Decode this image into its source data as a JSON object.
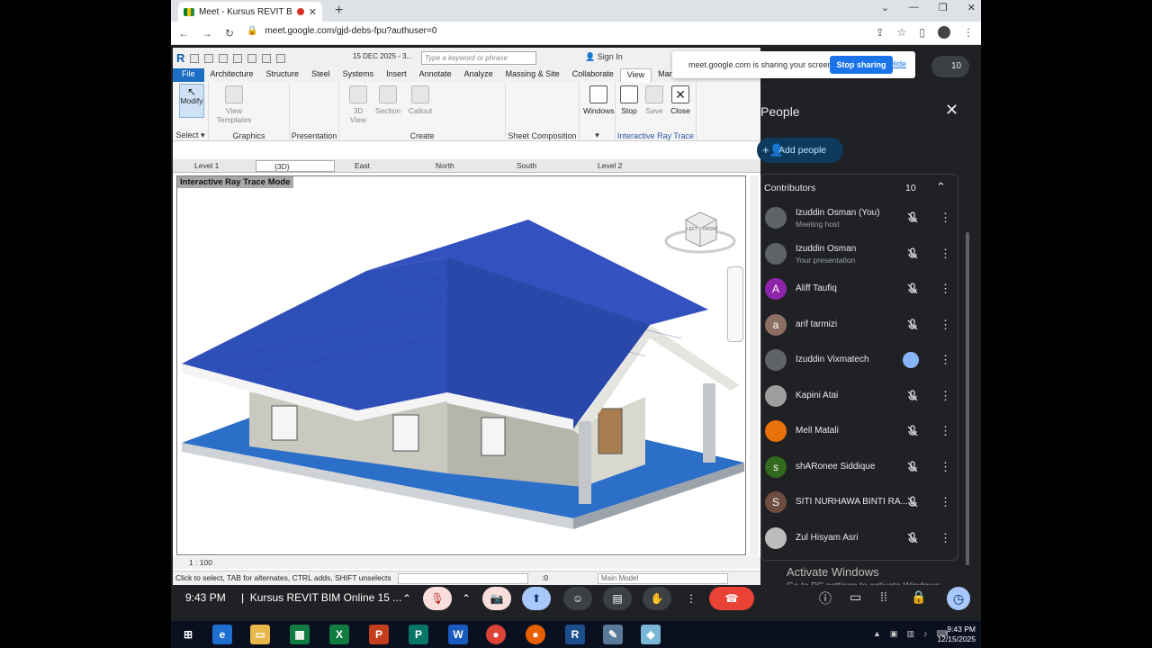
{
  "browser": {
    "tab_title": "Meet - Kursus REVIT BIM Onli",
    "url": "meet.google.com/gjd-debs-fpu?authuser=0"
  },
  "share_popup": {
    "message": "meet.google.com is sharing your screen.",
    "stop_label": "Stop sharing",
    "hide_label": "Hide"
  },
  "revit": {
    "date_field": "15 DEC 2025 - 3...",
    "search_placeholder": "Type a keyword or phrase",
    "signin_label": "Sign In",
    "menus": [
      "File",
      "Architecture",
      "Structure",
      "Steel",
      "Systems",
      "Insert",
      "Annotate",
      "Analyze",
      "Massing & Site",
      "Collaborate",
      "View",
      "Manage"
    ],
    "ribbon": {
      "modify_label": "Modify",
      "select_group": "Select",
      "view_templates": "View Templates",
      "graphics_group": "Graphics",
      "presentation_group": "Presentation",
      "view3d_label": "3D View",
      "section_label": "Section",
      "callout_label": "Callout",
      "create_group": "Create",
      "sheet_group": "Sheet Composition",
      "windows_label": "Windows",
      "stop_label": "Stop",
      "save_label": "Save",
      "close_label": "Close",
      "irt_group": "Interactive Ray Trace"
    },
    "view_tabs": [
      "Level 1",
      "{3D}",
      "East",
      "North",
      "South",
      "Level 2"
    ],
    "mode_label": "Interactive Ray Trace Mode",
    "scale": "1 : 100",
    "status_text": "Click to select, TAB for alternates, CTRL adds, SHIFT unselects",
    "status_zero": ":0",
    "model_field": "Main Model",
    "viewcube_left": "LEFT",
    "viewcube_front": "FRONT"
  },
  "people": {
    "title": "People",
    "add_label": "Add people",
    "contributors_label": "Contributors",
    "contributors_count": "10",
    "top_count": "10",
    "list": [
      {
        "name": "Izuddin Osman (You)",
        "sub": "Meeting host",
        "initial": "",
        "color": "#5f6368",
        "speaking": false
      },
      {
        "name": "Izuddin Osman",
        "sub": "Your presentation",
        "initial": "",
        "color": "#5f6368",
        "speaking": false
      },
      {
        "name": "Aliff Taufiq",
        "sub": "",
        "initial": "A",
        "color": "#8e24aa",
        "speaking": false
      },
      {
        "name": "arif tarmizi",
        "sub": "",
        "initial": "a",
        "color": "#8d6e63",
        "speaking": false
      },
      {
        "name": "Izuddin Vixmatech",
        "sub": "",
        "initial": "",
        "color": "#5f6368",
        "speaking": true
      },
      {
        "name": "Kapini Atai",
        "sub": "",
        "initial": "",
        "color": "#9e9e9e",
        "speaking": false
      },
      {
        "name": "Mell Matali",
        "sub": "",
        "initial": "",
        "color": "#e8710a",
        "speaking": false
      },
      {
        "name": "shARonee Siddique",
        "sub": "",
        "initial": "s",
        "color": "#33691e",
        "speaking": false
      },
      {
        "name": "SITI NURHAWA BINTI RA...",
        "sub": "",
        "initial": "S",
        "color": "#6d4c41",
        "speaking": false
      },
      {
        "name": "Zul Hisyam Asri",
        "sub": "",
        "initial": "",
        "color": "#bdbdbd",
        "speaking": false
      }
    ]
  },
  "meet": {
    "time": "9:43 PM",
    "meeting_name": "Kursus REVIT BIM Online 15 ..."
  },
  "watermark": {
    "title": "Activate Windows",
    "sub": "Go to PC settings to activate Windows."
  },
  "taskbar": {
    "time": "9:43 PM",
    "date": "12/15/2025"
  },
  "colors": {
    "roof_blue": "#2f4fb8",
    "meet_dark": "#202124",
    "accent_blue": "#1a73e8",
    "hangup_red": "#ea4335"
  }
}
